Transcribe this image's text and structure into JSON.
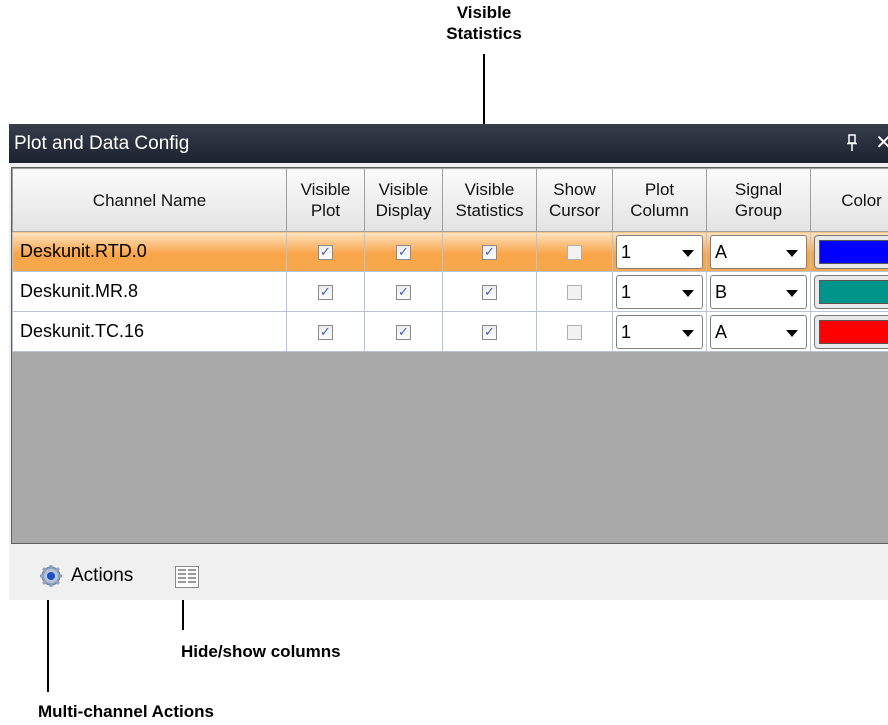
{
  "callouts": {
    "top_line1": "Visible",
    "top_line2": "Statistics",
    "hide_show": "Hide/show columns",
    "multi": "Multi-channel Actions"
  },
  "panel": {
    "title": "Plot and Data Config",
    "pin_icon": "pin-icon",
    "close_icon": "close-icon"
  },
  "grid": {
    "headers": [
      [
        "Channel Name"
      ],
      [
        "Visible",
        "Plot"
      ],
      [
        "Visible",
        "Display"
      ],
      [
        "Visible",
        "Statistics"
      ],
      [
        "Show",
        "Cursor"
      ],
      [
        "Plot",
        "Column"
      ],
      [
        "Signal",
        "Group"
      ],
      [
        "Color"
      ]
    ],
    "rows": [
      {
        "name": "Deskunit.RTD.0",
        "visible_plot": true,
        "visible_display": true,
        "visible_statistics": true,
        "show_cursor": false,
        "plot_column": "1",
        "signal_group": "A",
        "color": "#0000ff",
        "selected": true
      },
      {
        "name": "Deskunit.MR.8",
        "visible_plot": true,
        "visible_display": true,
        "visible_statistics": true,
        "show_cursor": false,
        "plot_column": "1",
        "signal_group": "B",
        "color": "#00948a",
        "selected": false
      },
      {
        "name": "Deskunit.TC.16",
        "visible_plot": true,
        "visible_display": true,
        "visible_statistics": true,
        "show_cursor": false,
        "plot_column": "1",
        "signal_group": "A",
        "color": "#ff0000",
        "selected": false
      }
    ]
  },
  "footer": {
    "actions_label": "Actions",
    "actions_icon": "gear-icon",
    "columns_icon": "columns-icon"
  }
}
